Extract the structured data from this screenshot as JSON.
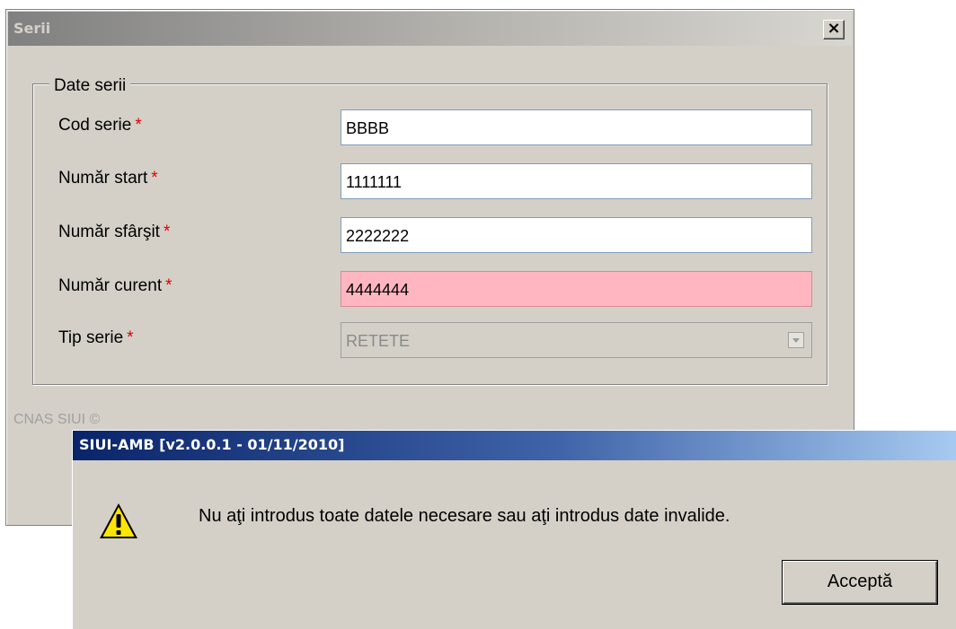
{
  "main_window": {
    "title": "Serii",
    "close_glyph": "✕",
    "group_title": "Date serii",
    "fields": [
      {
        "label": "Cod serie",
        "required_mark": "*",
        "value": "BBBB"
      },
      {
        "label": "Număr start",
        "required_mark": "*",
        "value": "1111111"
      },
      {
        "label": "Număr sfârşit",
        "required_mark": "*",
        "value": "2222222"
      },
      {
        "label": "Număr curent",
        "required_mark": "*",
        "value": "4444444",
        "state": "invalid"
      },
      {
        "label": "Tip serie",
        "required_mark": "*",
        "value": "RETETE",
        "state": "disabled"
      }
    ],
    "footer_text": "CNAS SIUI ©"
  },
  "dialog": {
    "title": "SIUI-AMB [v2.0.0.1 - 01/11/2010]",
    "icon": "warning-icon",
    "message": "Nu aţi introdus toate datele necesare sau aţi introdus date invalide.",
    "ok_label": "Acceptă"
  },
  "colors": {
    "invalid_field_bg": "#ffb6c1",
    "required_mark": "#e00000",
    "dialog_title_start": "#0a246a",
    "dialog_title_end": "#a6caf0"
  }
}
